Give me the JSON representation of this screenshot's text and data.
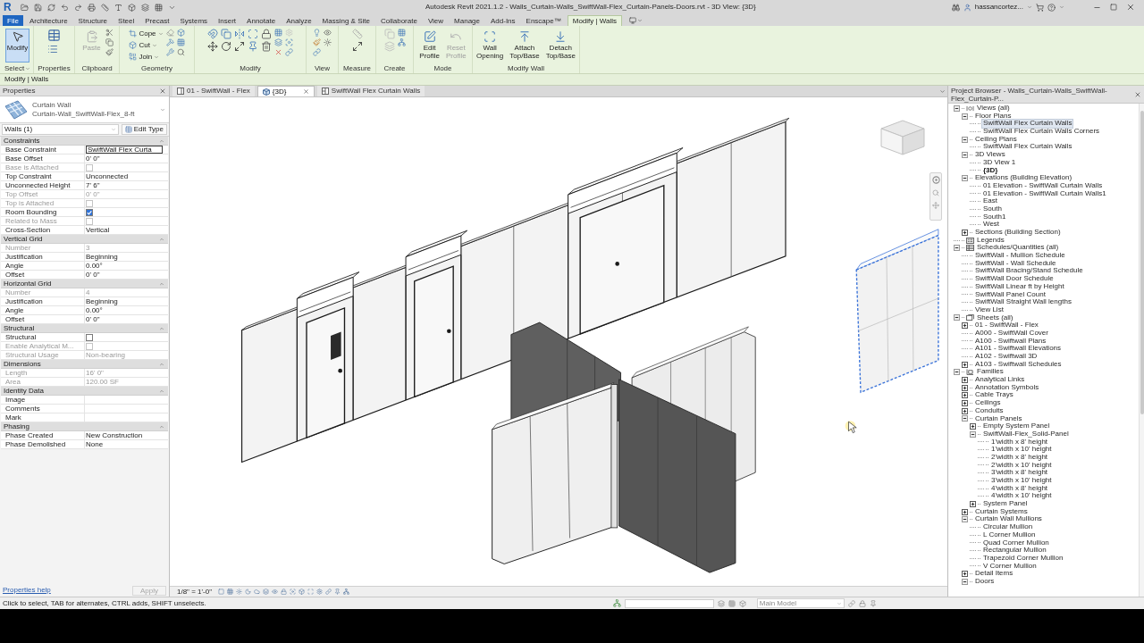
{
  "window": {
    "app_logo": "R",
    "title": "Autodesk Revit 2021.1.2 - Walls_Curtain-Walls_SwiftWall-Flex_Curtain-Panels-Doors.rvt - 3D View: {3D}",
    "user": "hassancortez..."
  },
  "ribbon": {
    "tabs": [
      {
        "label": "File",
        "kind": "file",
        "selected": false
      },
      {
        "label": "Architecture",
        "kind": "tab",
        "selected": false
      },
      {
        "label": "Structure",
        "kind": "tab",
        "selected": false
      },
      {
        "label": "Steel",
        "kind": "tab",
        "selected": false
      },
      {
        "label": "Precast",
        "kind": "tab",
        "selected": false
      },
      {
        "label": "Systems",
        "kind": "tab",
        "selected": false
      },
      {
        "label": "Insert",
        "kind": "tab",
        "selected": false
      },
      {
        "label": "Annotate",
        "kind": "tab",
        "selected": false
      },
      {
        "label": "Analyze",
        "kind": "tab",
        "selected": false
      },
      {
        "label": "Massing & Site",
        "kind": "tab",
        "selected": false
      },
      {
        "label": "Collaborate",
        "kind": "tab",
        "selected": false
      },
      {
        "label": "View",
        "kind": "tab",
        "selected": false
      },
      {
        "label": "Manage",
        "kind": "tab",
        "selected": false
      },
      {
        "label": "Add-Ins",
        "kind": "tab",
        "selected": false
      },
      {
        "label": "Enscape™",
        "kind": "tab",
        "selected": false
      },
      {
        "label": "Modify | Walls",
        "kind": "tab",
        "selected": true
      }
    ],
    "panels": [
      {
        "title": "Select",
        "menu": true,
        "buttons": [
          {
            "label": "Modify",
            "kind": "large",
            "selected": true
          }
        ]
      },
      {
        "title": "Properties",
        "menu": false
      },
      {
        "title": "Clipboard",
        "menu": false,
        "buttons": [
          {
            "label": "Paste",
            "kind": "large",
            "disabled": true
          }
        ]
      },
      {
        "title": "Geometry",
        "menu": false,
        "buttons": [
          {
            "label": "Cope",
            "kind": "small"
          },
          {
            "label": "Cut",
            "kind": "small"
          },
          {
            "label": "Join",
            "kind": "small"
          }
        ]
      },
      {
        "title": "Modify",
        "menu": false
      },
      {
        "title": "View",
        "menu": false
      },
      {
        "title": "Measure",
        "menu": false
      },
      {
        "title": "Create",
        "menu": false
      },
      {
        "title": "Mode",
        "menu": false,
        "buttons": [
          {
            "label": "Edit Profile",
            "kind": "large",
            "disabled": false
          },
          {
            "label": "Reset Profile",
            "kind": "large",
            "disabled": true
          }
        ]
      },
      {
        "title": "Modify Wall",
        "menu": false,
        "buttons": [
          {
            "label": "Wall Opening",
            "kind": "large"
          },
          {
            "label": "Attach Top/Base",
            "kind": "large"
          },
          {
            "label": "Detach Top/Base",
            "kind": "large"
          }
        ]
      }
    ]
  },
  "options_bar": {
    "context": "Modify | Walls"
  },
  "properties": {
    "title": "Properties",
    "type_family": "Curtain Wall",
    "type_name": "Curtain-Wall_SwiftWall-Flex_8-ft",
    "filter": "Walls (1)",
    "edit_type": "Edit Type",
    "groups": [
      {
        "title": "Constraints",
        "rows": [
          {
            "label": "Base Constraint",
            "kind": "field",
            "value": "SwiftWall Flex Curta",
            "disabled": false
          },
          {
            "label": "Base Offset",
            "kind": "text",
            "value": "0' 0\"",
            "disabled": false
          },
          {
            "label": "Base is Attached",
            "kind": "checkbox",
            "checked": false,
            "disabled": true
          },
          {
            "label": "Top Constraint",
            "kind": "text",
            "value": "Unconnected",
            "disabled": false
          },
          {
            "label": "Unconnected Height",
            "kind": "text",
            "value": "7' 6\"",
            "disabled": false
          },
          {
            "label": "Top Offset",
            "kind": "text",
            "value": "0' 0\"",
            "disabled": true
          },
          {
            "label": "Top is Attached",
            "kind": "checkbox",
            "checked": false,
            "disabled": true
          },
          {
            "label": "Room Bounding",
            "kind": "checkbox",
            "checked": true,
            "disabled": false
          },
          {
            "label": "Related to Mass",
            "kind": "checkbox",
            "checked": false,
            "disabled": true
          },
          {
            "label": "Cross-Section",
            "kind": "text",
            "value": "Vertical",
            "disabled": false
          }
        ]
      },
      {
        "title": "Vertical Grid",
        "rows": [
          {
            "label": "Number",
            "kind": "text",
            "value": "3",
            "disabled": true
          },
          {
            "label": "Justification",
            "kind": "text",
            "value": "Beginning",
            "disabled": false
          },
          {
            "label": "Angle",
            "kind": "text",
            "value": "0.00°",
            "disabled": false
          },
          {
            "label": "Offset",
            "kind": "text",
            "value": "0' 0\"",
            "disabled": false
          }
        ]
      },
      {
        "title": "Horizontal Grid",
        "rows": [
          {
            "label": "Number",
            "kind": "text",
            "value": "4",
            "disabled": true
          },
          {
            "label": "Justification",
            "kind": "text",
            "value": "Beginning",
            "disabled": false
          },
          {
            "label": "Angle",
            "kind": "text",
            "value": "0.00°",
            "disabled": false
          },
          {
            "label": "Offset",
            "kind": "text",
            "value": "0' 0\"",
            "disabled": false
          }
        ]
      },
      {
        "title": "Structural",
        "rows": [
          {
            "label": "Structural",
            "kind": "checkbox",
            "checked": false,
            "disabled": false
          },
          {
            "label": "Enable Analytical M...",
            "kind": "checkbox",
            "checked": false,
            "disabled": true
          },
          {
            "label": "Structural Usage",
            "kind": "text",
            "value": "Non-bearing",
            "disabled": true
          }
        ]
      },
      {
        "title": "Dimensions",
        "rows": [
          {
            "label": "Length",
            "kind": "text",
            "value": "16' 0\"",
            "disabled": true
          },
          {
            "label": "Area",
            "kind": "text",
            "value": "120.00 SF",
            "disabled": true
          }
        ]
      },
      {
        "title": "Identity Data",
        "rows": [
          {
            "label": "Image",
            "kind": "text",
            "disabled": false
          },
          {
            "label": "Comments",
            "kind": "text",
            "disabled": false
          },
          {
            "label": "Mark",
            "kind": "text",
            "disabled": false
          }
        ]
      },
      {
        "title": "Phasing",
        "rows": [
          {
            "label": "Phase Created",
            "kind": "text",
            "value": "New Construction",
            "disabled": false
          },
          {
            "label": "Phase Demolished",
            "kind": "text",
            "value": "None",
            "disabled": false
          }
        ]
      }
    ],
    "help_link": "Properties help",
    "apply": {
      "label": "Apply",
      "disabled": true
    }
  },
  "view": {
    "tabs": [
      {
        "label": "01 - SwiftWall - Flex",
        "selected": false
      },
      {
        "label": "{3D}",
        "selected": true
      },
      {
        "label": "SwiftWall Flex Curtain Walls",
        "selected": false
      }
    ],
    "scale": "1/8\" = 1'-0\""
  },
  "browser": {
    "title": "Project Browser - Walls_Curtain-Walls_SwiftWall-Flex_Curtain-P...",
    "tree": [
      {
        "label": "Views (all)",
        "expanded": true,
        "children": [
          {
            "label": "Floor Plans",
            "expanded": true,
            "children": [
              {
                "label": "SwiftWall Flex Curtain Walls",
                "selected": true
              },
              {
                "label": "SwiftWall Flex Curtain Walls Corners",
                "selected": false
              }
            ]
          },
          {
            "label": "Ceiling Plans",
            "expanded": true,
            "children": [
              {
                "label": "SwiftWall Flex Curtain Walls"
              }
            ]
          },
          {
            "label": "3D Views",
            "expanded": true,
            "children": [
              {
                "label": "3D View 1",
                "bold": false
              },
              {
                "label": "{3D}",
                "bold": true
              }
            ]
          },
          {
            "label": "Elevations (Building Elevation)",
            "expanded": true,
            "children": [
              {
                "label": "01 Elevation - SwiftWall Curtain Walls"
              },
              {
                "label": "01 Elevation - SwiftWall Curtain Walls1"
              },
              {
                "label": "East"
              },
              {
                "label": "South"
              },
              {
                "label": "South1"
              },
              {
                "label": "West"
              }
            ]
          },
          {
            "label": "Sections (Building Section)",
            "expanded": false
          }
        ]
      },
      {
        "label": "Legends"
      },
      {
        "label": "Schedules/Quantities (all)",
        "expanded": true,
        "children": [
          {
            "label": "SwiftWall - Mullion Schedule"
          },
          {
            "label": "SwiftWall - Wall Schedule"
          },
          {
            "label": "SwiftWall Bracing/Stand Schedule"
          },
          {
            "label": "SwiftWall Door Schedule"
          },
          {
            "label": "SwiftWall Linear ft by Height"
          },
          {
            "label": "SwiftWall Panel Count"
          },
          {
            "label": "SwiftWall Straight Wall lengths"
          },
          {
            "label": "View List"
          }
        ]
      },
      {
        "label": "Sheets (all)",
        "expanded": true,
        "children": [
          {
            "label": "01 - SwiftWall - Flex",
            "expanded": false
          },
          {
            "label": "A000 - SwiftWall Cover"
          },
          {
            "label": "A100 - Swiftwall Plans"
          },
          {
            "label": "A101 - Swiftwall Elevations"
          },
          {
            "label": "A102 - Swiftwall 3D"
          },
          {
            "label": "A103 - Swiftwall Schedules",
            "expanded": false
          }
        ]
      },
      {
        "label": "Families",
        "expanded": true,
        "children": [
          {
            "label": "Analytical Links",
            "expanded": false
          },
          {
            "label": "Annotation Symbols",
            "expanded": false
          },
          {
            "label": "Cable Trays",
            "expanded": false
          },
          {
            "label": "Ceilings",
            "expanded": false
          },
          {
            "label": "Conduits",
            "expanded": false
          },
          {
            "label": "Curtain Panels",
            "expanded": true,
            "children": [
              {
                "label": "Empty System Panel",
                "expanded": false
              },
              {
                "label": "SwiftWall-Flex_Solid-Panel",
                "expanded": true,
                "children": [
                  {
                    "label": "1'width x 8' height"
                  },
                  {
                    "label": "1'width x 10' height"
                  },
                  {
                    "label": "2'width x 8' height"
                  },
                  {
                    "label": "2'width x 10' height"
                  },
                  {
                    "label": "3'width x 8' height"
                  },
                  {
                    "label": "3'width x 10' height"
                  },
                  {
                    "label": "4'width x 8' height"
                  },
                  {
                    "label": "4'width x 10' height"
                  }
                ]
              },
              {
                "label": "System Panel",
                "expanded": false
              }
            ]
          },
          {
            "label": "Curtain Systems",
            "expanded": false
          },
          {
            "label": "Curtain Wall Mullions",
            "expanded": true,
            "children": [
              {
                "label": "Circular Mullion"
              },
              {
                "label": "L Corner Mullion"
              },
              {
                "label": "Quad Corner Mullion"
              },
              {
                "label": "Rectangular Mullion"
              },
              {
                "label": "Trapezoid Corner Mullion"
              },
              {
                "label": "V Corner Mullion"
              }
            ]
          },
          {
            "label": "Detail Items",
            "expanded": false
          },
          {
            "label": "Doors",
            "expanded": true
          }
        ]
      }
    ]
  },
  "status_bar": {
    "hint": "Click to select, TAB for alternates, CTRL adds, SHIFT unselects.",
    "workset": "Main Model"
  }
}
